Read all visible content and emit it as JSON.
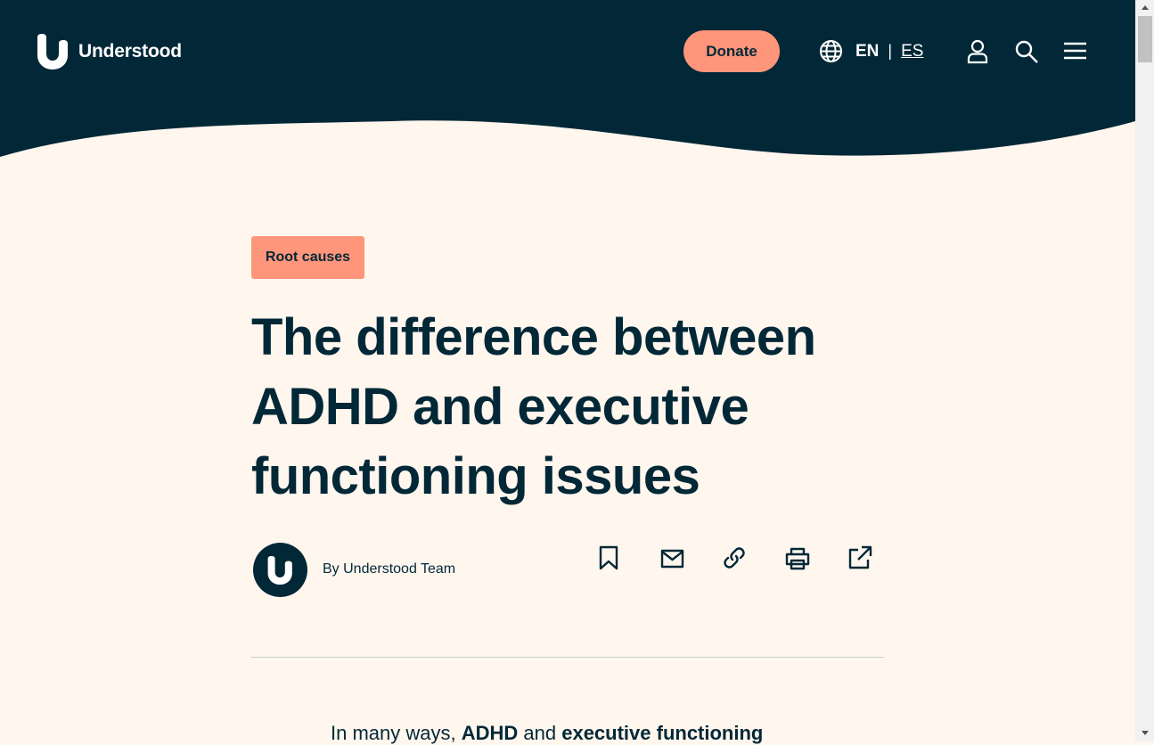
{
  "header": {
    "brand_name": "Understood",
    "donate_label": "Donate",
    "lang_current": "EN",
    "lang_separator": "|",
    "lang_alt": "ES",
    "icons": [
      "globe-icon",
      "user-icon",
      "search-icon",
      "menu-icon"
    ]
  },
  "article": {
    "tag": "Root causes",
    "title": "The difference between ADHD and executive functioning issues",
    "byline": "By Understood Team",
    "share_icons": [
      "bookmark-icon",
      "mail-icon",
      "link-icon",
      "print-icon",
      "external-share-icon"
    ],
    "intro": {
      "t1": "In many ways, ",
      "b1": "ADHD",
      "t2": " and ",
      "b2": "executive functioning"
    }
  },
  "colors": {
    "navy": "#022837",
    "cream": "#fff6ee",
    "coral": "#ff957a",
    "white": "#ffffff"
  }
}
